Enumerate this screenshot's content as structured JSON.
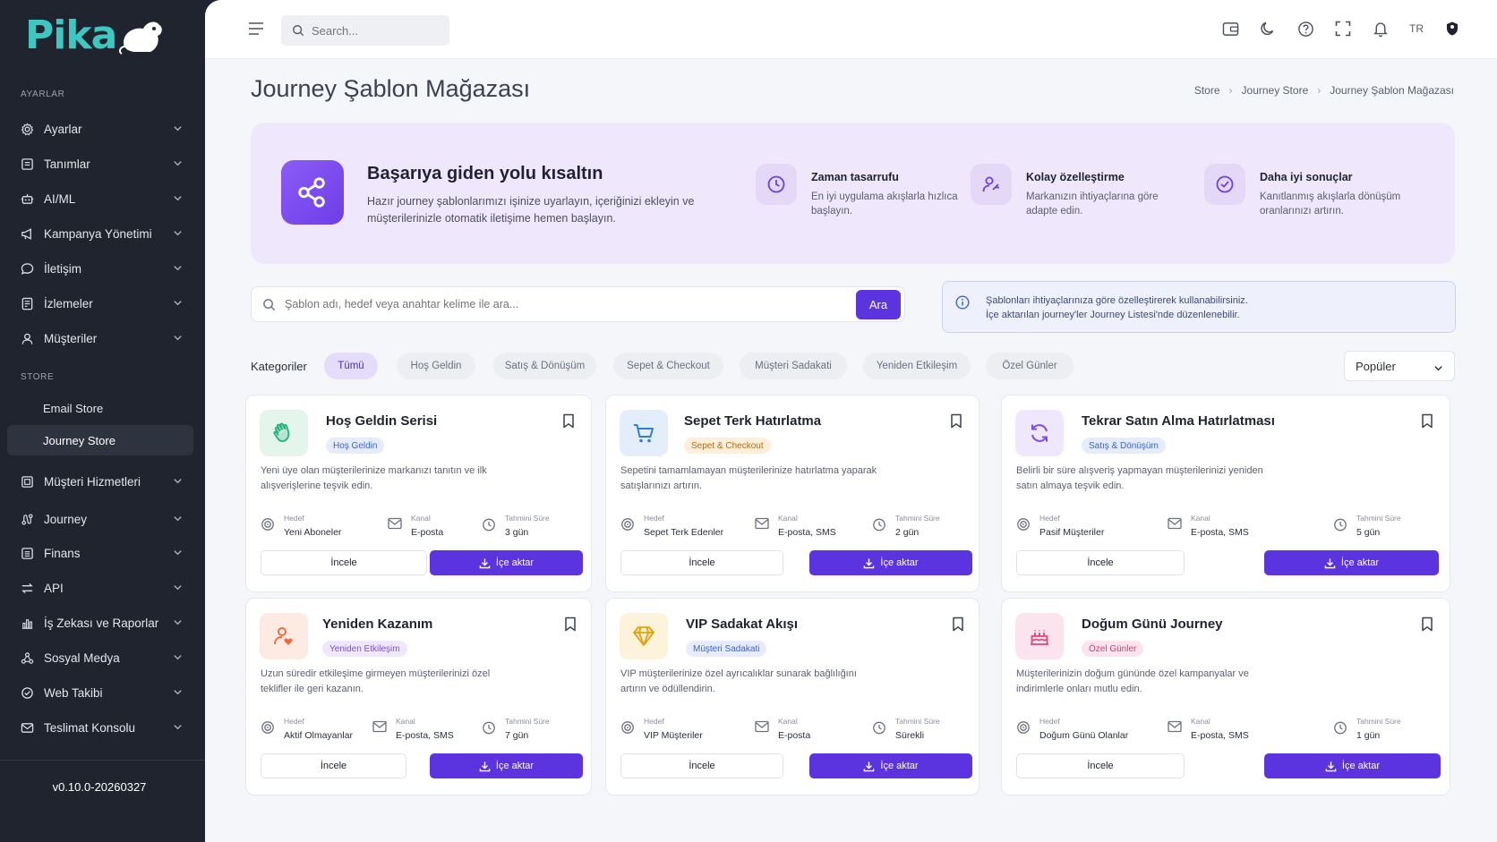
{
  "colors": {
    "accent": "#5b34e0",
    "sidebar_bg": "#20242e",
    "logo": "#3ec6c0",
    "hero_bg": "#efe7fb"
  },
  "sidebar": {
    "logo_text": "Pika",
    "section_settings": "AYARLAR",
    "section_store": "STORE",
    "items": [
      {
        "label": "Ayarlar",
        "icon": "gear-icon"
      },
      {
        "label": "Tanımlar",
        "icon": "list-icon"
      },
      {
        "label": "AI/ML",
        "icon": "robot-icon"
      },
      {
        "label": "Kampanya Yönetimi",
        "icon": "megaphone-icon"
      },
      {
        "label": "İletişim",
        "icon": "chat-icon"
      },
      {
        "label": "İzlemeler",
        "icon": "report-icon"
      },
      {
        "label": "Müşteriler",
        "icon": "user-icon"
      }
    ],
    "store_items": [
      {
        "label": "Email Store"
      },
      {
        "label": "Journey Store"
      }
    ],
    "items2": [
      {
        "label": "Müşteri Hizmetleri",
        "icon": "support-icon"
      },
      {
        "label": "Journey",
        "icon": "journey-icon"
      },
      {
        "label": "Finans",
        "icon": "finance-icon"
      },
      {
        "label": "API",
        "icon": "api-icon"
      },
      {
        "label": "İş Zekası ve Raporlar",
        "icon": "chart-icon"
      },
      {
        "label": "Sosyal Medya",
        "icon": "social-icon"
      },
      {
        "label": "Web Takibi",
        "icon": "web-icon"
      },
      {
        "label": "Teslimat Konsolu",
        "icon": "delivery-icon"
      }
    ],
    "version": "v0.10.0-20260327"
  },
  "topbar": {
    "search_placeholder": "Search...",
    "lang": "TR"
  },
  "page": {
    "title": "Journey Şablon Mağazası",
    "breadcrumb": [
      "Store",
      "Journey Store",
      "Journey Şablon Mağazası"
    ]
  },
  "hero": {
    "title": "Başarıya giden yolu kısaltın",
    "desc": "Hazır journey şablonlarımızı işinize uyarlayın, içeriğinizi ekleyin ve müşterilerinizle otomatik iletişime hemen başlayın.",
    "features": [
      {
        "title": "Zaman tasarrufu",
        "desc": "En iyi uygulama akışlarla hızlıca başlayın.",
        "icon": "clock-icon"
      },
      {
        "title": "Kolay özelleştirme",
        "desc": "Markanızın ihtiyaçlarına göre adapte edin.",
        "icon": "user-edit-icon"
      },
      {
        "title": "Daha iyi sonuçlar",
        "desc": "Kanıtlanmış akışlarla dönüşüm oranlarınızı artırın.",
        "icon": "trend-icon"
      }
    ]
  },
  "search": {
    "placeholder": "Şablon adı, hedef veya anahtar kelime ile ara...",
    "button": "Ara"
  },
  "info": {
    "line1": "Şablonları ihtiyaçlarınıza göre özelleştirerek kullanabilirsiniz.",
    "line2": "İçe aktarılan journey'ler Journey Listesi'nde düzenlenebilir."
  },
  "categories": {
    "label": "Kategoriler",
    "chips": [
      "Tümü",
      "Hoş Geldin",
      "Satış & Dönüşüm",
      "Sepet & Checkout",
      "Müşteri Sadakati",
      "Yeniden Etkileşim",
      "Özel Günler"
    ],
    "active": "Tümü",
    "sort": "Popüler"
  },
  "labels": {
    "target": "Hedef",
    "channel": "Kanal",
    "duration": "Tahmini Süre",
    "review": "İncele",
    "import": "İçe aktar"
  },
  "cards": [
    {
      "title": "Hoş Geldin Serisi",
      "badge": "Hoş Geldin",
      "desc": "Yeni üye olan müşterilerinize markanızı tanıtın ve ilk alışverişlerine teşvik edin.",
      "target": "Yeni Aboneler",
      "channel": "E-posta",
      "duration": "3 gün",
      "icon": "wave-hand-icon",
      "icon_color": "#22b07d",
      "icon_bg": "#e4f6ec",
      "badge_color": "#3a63d8",
      "badge_bg": "#e6ecfb"
    },
    {
      "title": "Sepet Terk Hatırlatma",
      "badge": "Sepet & Checkout",
      "desc": "Sepetini tamamlamayan müşterilerinize hatırlatma yaparak satışlarınızı artırın.",
      "target": "Sepet Terk Edenler",
      "channel": "E-posta, SMS",
      "duration": "2 gün",
      "icon": "cart-icon",
      "icon_color": "#2f7fd8",
      "icon_bg": "#e4eefb",
      "badge_color": "#b86a12",
      "badge_bg": "#fcefdc"
    },
    {
      "title": "Tekrar Satın Alma Hatırlatması",
      "badge": "Satış & Dönüşüm",
      "desc": "Belirli bir süre alışveriş yapmayan müşterilerinizi yeniden satın almaya teşvik edin.",
      "target": "Pasif Müşteriler",
      "channel": "E-posta, SMS",
      "duration": "5 gün",
      "icon": "refresh-icon",
      "icon_color": "#7c4ee4",
      "icon_bg": "#efe7fb",
      "badge_color": "#3a63d8",
      "badge_bg": "#e6ecfb"
    },
    {
      "title": "Yeniden Kazanım",
      "badge": "Yeniden Etkileşim",
      "desc": "Uzun süredir etkileşime girmeyen müşterilerinizi özel teklifler ile geri kazanın.",
      "target": "Aktif Olmayanlar",
      "channel": "E-posta, SMS",
      "duration": "7 gün",
      "icon": "user-heart-icon",
      "icon_color": "#ef6a3a",
      "icon_bg": "#fdeae2",
      "badge_color": "#7c4ee4",
      "badge_bg": "#efe7fb"
    },
    {
      "title": "VIP Sadakat Akışı",
      "badge": "Müşteri Sadakati",
      "desc": "VIP müşterilerinize özel ayrıcalıklar sunarak bağlılığını artırın ve ödüllendirin.",
      "target": "VIP Müşteriler",
      "channel": "E-posta",
      "duration": "Sürekli",
      "icon": "diamond-icon",
      "icon_color": "#e0a30f",
      "icon_bg": "#fdf3da",
      "badge_color": "#3a63d8",
      "badge_bg": "#e6ecfb"
    },
    {
      "title": "Doğum Günü Journey",
      "badge": "Özel Günler",
      "desc": "Müşterilerinizin doğum gününde özel kampanyalar ve indirimlerle onları mutlu edin.",
      "target": "Doğum Günü Olanlar",
      "channel": "E-posta, SMS",
      "duration": "1 gün",
      "icon": "cake-icon",
      "icon_color": "#e0457b",
      "icon_bg": "#fce4ee",
      "badge_color": "#d23b72",
      "badge_bg": "#fce4ee"
    }
  ]
}
